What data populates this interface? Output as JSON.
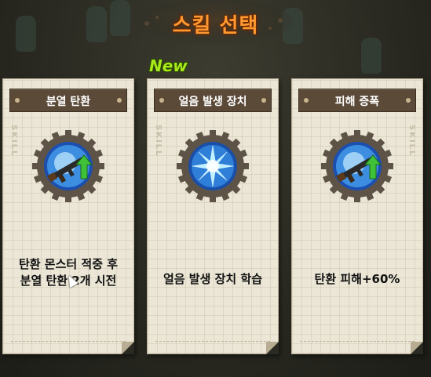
{
  "screen": {
    "title": "스킬 선택",
    "new_badge": "New",
    "watermark": "SKILL"
  },
  "colors": {
    "title": "#ff9a32",
    "new_badge": "#a8e81c",
    "card_header": "#5b4a38",
    "card_paper": "#ebe6d6"
  },
  "cards": [
    {
      "name": "분열 탄환",
      "icon": "rifle-upgrade-icon",
      "description_lines": [
        "탄환 몬스터 적중 후",
        "분열 탄환 2개 시전"
      ]
    },
    {
      "name": "얼음 발생 장치",
      "icon": "ice-crystal-icon",
      "description_lines": [
        "얼음 발생 장치 학습"
      ]
    },
    {
      "name": "피해 증폭",
      "icon": "rifle-upgrade-icon",
      "description_lines": [
        "탄환 피해+60%"
      ]
    }
  ]
}
